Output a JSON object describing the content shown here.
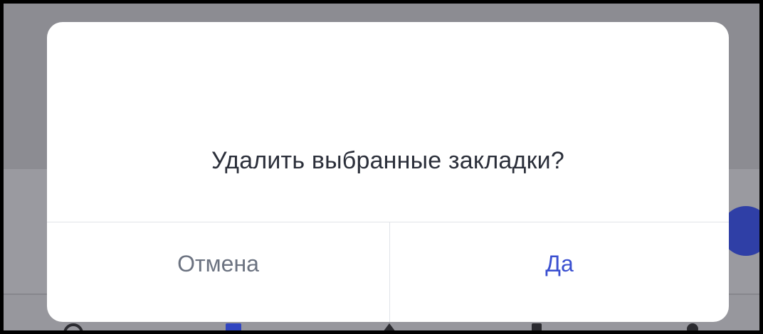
{
  "dialog": {
    "message": "Удалить выбранные закладки?",
    "cancel_label": "Отмена",
    "confirm_label": "Да"
  },
  "colors": {
    "overlay_bg": "#8e8e93",
    "dialog_bg": "#ffffff",
    "message_text": "#2b2f3a",
    "cancel_text": "#6b7280",
    "confirm_text": "#3a4fd0",
    "fab": "#2f3fa6"
  },
  "icons": [
    "search-icon",
    "bookmark-icon",
    "home-icon",
    "document-icon",
    "profile-icon"
  ]
}
